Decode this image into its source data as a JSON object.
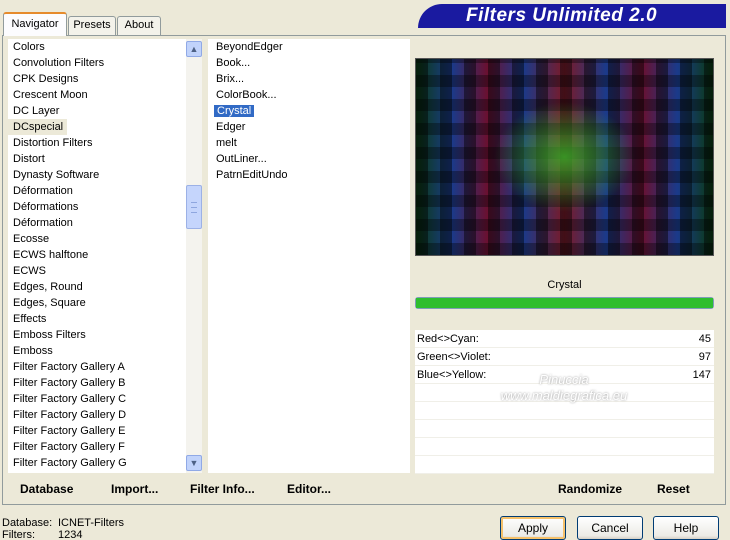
{
  "tabs": [
    "Navigator",
    "Presets",
    "About"
  ],
  "banner": "Filters Unlimited 2.0",
  "categories": [
    "Colors",
    "Convolution Filters",
    "CPK Designs",
    "Crescent Moon",
    "DC Layer",
    "DCspecial",
    "Distortion Filters",
    "Distort",
    "Dynasty Software",
    "Déformation",
    "Déformations",
    "Déformation",
    "Ecosse",
    "ECWS halftone",
    "ECWS",
    "Edges, Round",
    "Edges, Square",
    "Effects",
    "Emboss Filters",
    "Emboss",
    "Filter Factory Gallery A",
    "Filter Factory Gallery B",
    "Filter Factory Gallery C",
    "Filter Factory Gallery D",
    "Filter Factory Gallery E",
    "Filter Factory Gallery F",
    "Filter Factory Gallery G"
  ],
  "selected_category": "DCspecial",
  "filters": [
    "BeyondEdger",
    "Book...",
    "Brix...",
    "ColorBook...",
    "Crystal",
    "Edger",
    "melt",
    "OutLiner...",
    "PatrnEditUndo"
  ],
  "selected_filter": "Crystal",
  "preview_label": "Crystal",
  "progress": 1.0,
  "params": [
    {
      "label": "Red<>Cyan:",
      "value": "45"
    },
    {
      "label": "Green<>Violet:",
      "value": "97"
    },
    {
      "label": "Blue<>Yellow:",
      "value": "147"
    }
  ],
  "watermark": {
    "line1": "Pinuccia",
    "line2": "www.maldiegrafica.eu"
  },
  "bottom_left": {
    "database": "Database",
    "import": "Import...",
    "filter_info": "Filter Info...",
    "editor": "Editor..."
  },
  "bottom_right": {
    "randomize": "Randomize",
    "reset": "Reset"
  },
  "info": {
    "db_label": "Database:",
    "db_value": "ICNET-Filters",
    "filters_label": "Filters:",
    "filters_value": "1234"
  },
  "buttons": {
    "apply": "Apply",
    "cancel": "Cancel",
    "help": "Help"
  }
}
